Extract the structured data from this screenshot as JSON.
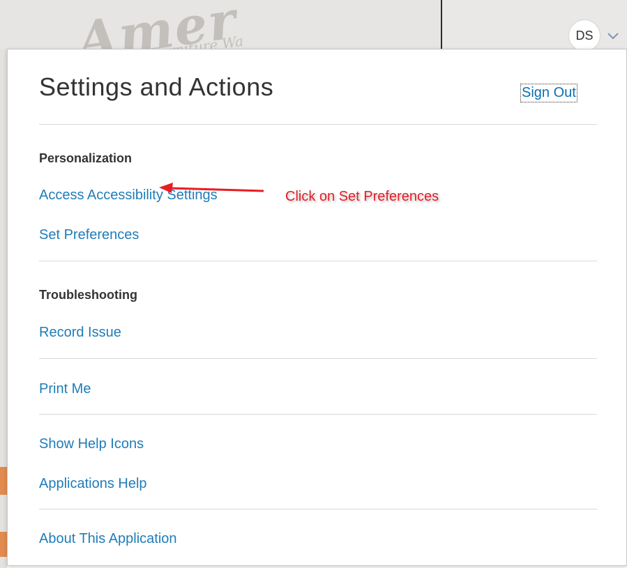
{
  "header": {
    "avatar_initials": "DS",
    "menu_chevron_icon": "chevron-down-icon",
    "background_logo": {
      "text": "Amer",
      "subtext": "Furniture Wa"
    }
  },
  "panel": {
    "title": "Settings and Actions",
    "sign_out_label": "Sign Out",
    "sections": {
      "personalization": {
        "heading": "Personalization",
        "items": [
          "Access Accessibility Settings",
          "Set Preferences"
        ]
      },
      "troubleshooting": {
        "heading": "Troubleshooting",
        "items": [
          "Record Issue"
        ]
      },
      "print": {
        "items": [
          "Print Me"
        ]
      },
      "help": {
        "items": [
          "Show Help Icons",
          "Applications Help"
        ]
      },
      "about": {
        "items": [
          "About This Application"
        ]
      }
    }
  },
  "annotation": {
    "callout_text": "Click on Set Preferences",
    "arrow_icon": "arrow-left-icon"
  },
  "colors": {
    "link": "#1f7cb8",
    "annotation": "#e81c24",
    "text": "#333333"
  }
}
